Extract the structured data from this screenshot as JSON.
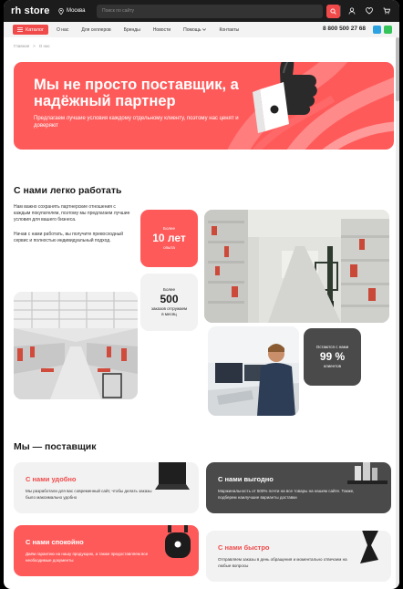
{
  "header": {
    "logo": "rh store",
    "city": "Москва",
    "search_placeholder": "Поиск по сайту",
    "icons": [
      "location-icon",
      "search-icon",
      "user-icon",
      "heart-icon",
      "cart-icon"
    ]
  },
  "nav": {
    "catalog_label": "Каталог",
    "items": [
      "О нас",
      "Для селлеров",
      "Бренды",
      "Новости",
      "Помощь",
      "Контакты"
    ],
    "phone": "8 800 500 27 68"
  },
  "breadcrumb": [
    "Главная",
    ">",
    "О нас"
  ],
  "hero": {
    "title": "Мы не просто поставщик, а надёжный партнер",
    "subtitle": "Предлагаем лучшие условия каждому отдельному клиенту, поэтому нас ценят и доверяют"
  },
  "easy": {
    "title": "С нами легко работать",
    "p1": "Нам важно сохранять партнерские отношения с каждым покупателем, поэтому мы предлагаем лучшие условия для вашего бизнеса.",
    "p2": "Начав с нами работать, вы получите превосходный сервис и полностью индивидуальный подход."
  },
  "stats": {
    "s1": {
      "pre": "Более",
      "num": "10 лет",
      "post": "опыта"
    },
    "s2": {
      "pre": "Более",
      "num": "500",
      "post": "заказов отгружаем в месяц"
    },
    "s3": {
      "pre": "Остаются с нами",
      "num": "99 %",
      "post": "клиентов"
    }
  },
  "supplier": {
    "title": "Мы — поставщик",
    "cards": [
      {
        "title": "С нами удобно",
        "text": "Мы разработали для вас современный сайт, чтобы делать заказы было максимально удобно"
      },
      {
        "title": "С нами выгодно",
        "text": "Маржинальность от 500% почти на все товары на нашем сайте. Также, подберем наилучшие варианты доставки"
      },
      {
        "title": "С нами спокойно",
        "text": "Даём гарантию на нашу продукцию, а также предоставляем все необходимые документы"
      },
      {
        "title": "С нами быстро",
        "text": "Отправляем заказы в день обращения и моментально отвечаем на любые вопросы"
      }
    ]
  },
  "colors": {
    "accent": "#f04a4a",
    "hero": "#ff5a5a",
    "dark": "#1c1c1c",
    "card_gray": "#f2f2f2",
    "card_dark": "#4a4a4a"
  }
}
